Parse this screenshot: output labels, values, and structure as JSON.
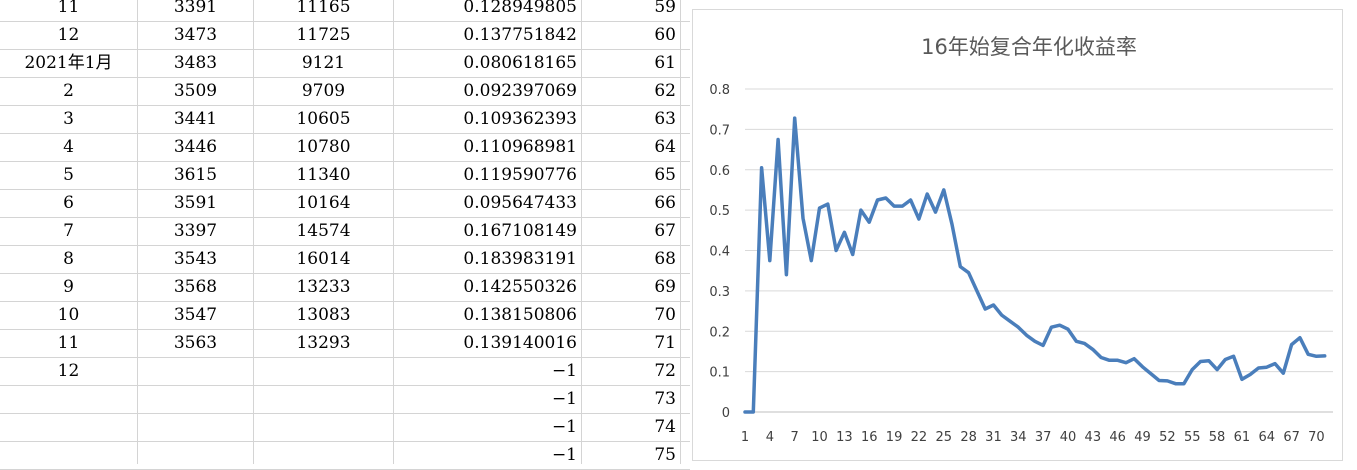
{
  "sheet": {
    "rows": [
      {
        "a": "11",
        "b": "3391",
        "c": "11165",
        "d": "0.128949805",
        "e": "59"
      },
      {
        "a": "12",
        "b": "3473",
        "c": "11725",
        "d": "0.137751842",
        "e": "60"
      },
      {
        "a": "2021年1月",
        "b": "3483",
        "c": "9121",
        "d": "0.080618165",
        "e": "61"
      },
      {
        "a": "2",
        "b": "3509",
        "c": "9709",
        "d": "0.092397069",
        "e": "62"
      },
      {
        "a": "3",
        "b": "3441",
        "c": "10605",
        "d": "0.109362393",
        "e": "63"
      },
      {
        "a": "4",
        "b": "3446",
        "c": "10780",
        "d": "0.110968981",
        "e": "64"
      },
      {
        "a": "5",
        "b": "3615",
        "c": "11340",
        "d": "0.119590776",
        "e": "65"
      },
      {
        "a": "6",
        "b": "3591",
        "c": "10164",
        "d": "0.095647433",
        "e": "66"
      },
      {
        "a": "7",
        "b": "3397",
        "c": "14574",
        "d": "0.167108149",
        "e": "67"
      },
      {
        "a": "8",
        "b": "3543",
        "c": "16014",
        "d": "0.183983191",
        "e": "68"
      },
      {
        "a": "9",
        "b": "3568",
        "c": "13233",
        "d": "0.142550326",
        "e": "69"
      },
      {
        "a": "10",
        "b": "3547",
        "c": "13083",
        "d": "0.138150806",
        "e": "70"
      },
      {
        "a": "11",
        "b": "3563",
        "c": "13293",
        "d": "0.139140016",
        "e": "71"
      },
      {
        "a": "12",
        "b": "",
        "c": "",
        "d": "−1",
        "e": "72"
      },
      {
        "a": "",
        "b": "",
        "c": "",
        "d": "−1",
        "e": "73"
      },
      {
        "a": "",
        "b": "",
        "c": "",
        "d": "−1",
        "e": "74"
      },
      {
        "a": "",
        "b": "",
        "c": "",
        "d": "−1",
        "e": "75"
      }
    ]
  },
  "chart_data": {
    "type": "line",
    "title": "16年始复合年化收益率",
    "xlabel": "",
    "ylabel": "",
    "ylim": [
      0,
      0.8
    ],
    "yticks": [
      "0",
      "0.1",
      "0.2",
      "0.3",
      "0.4",
      "0.5",
      "0.6",
      "0.7",
      "0.8"
    ],
    "xticks": [
      "1",
      "4",
      "7",
      "10",
      "13",
      "16",
      "19",
      "22",
      "25",
      "28",
      "31",
      "34",
      "37",
      "40",
      "43",
      "46",
      "49",
      "52",
      "55",
      "58",
      "61",
      "64",
      "67",
      "70"
    ],
    "grid": true,
    "legend": "none",
    "line_color": "#4a7ebb",
    "x": [
      1,
      2,
      3,
      4,
      5,
      6,
      7,
      8,
      9,
      10,
      11,
      12,
      13,
      14,
      15,
      16,
      17,
      18,
      19,
      20,
      21,
      22,
      23,
      24,
      25,
      26,
      27,
      28,
      29,
      30,
      31,
      32,
      33,
      34,
      35,
      36,
      37,
      38,
      39,
      40,
      41,
      42,
      43,
      44,
      45,
      46,
      47,
      48,
      49,
      50,
      51,
      52,
      53,
      54,
      55,
      56,
      57,
      58,
      59,
      60,
      61,
      62,
      63,
      64,
      65,
      66,
      67,
      68,
      69,
      70,
      71
    ],
    "values": [
      0,
      0,
      0.605,
      0.375,
      0.675,
      0.34,
      0.728,
      0.48,
      0.375,
      0.505,
      0.515,
      0.4,
      0.445,
      0.39,
      0.5,
      0.47,
      0.525,
      0.53,
      0.51,
      0.51,
      0.525,
      0.478,
      0.54,
      0.495,
      0.55,
      0.465,
      0.36,
      0.345,
      0.3,
      0.255,
      0.265,
      0.24,
      0.225,
      0.21,
      0.19,
      0.175,
      0.165,
      0.21,
      0.215,
      0.205,
      0.175,
      0.17,
      0.155,
      0.135,
      0.128,
      0.128,
      0.122,
      0.132,
      0.112,
      0.095,
      0.078,
      0.077,
      0.07,
      0.07,
      0.105,
      0.125,
      0.127,
      0.105,
      0.13,
      0.138,
      0.081,
      0.093,
      0.109,
      0.111,
      0.12,
      0.096,
      0.167,
      0.184,
      0.143,
      0.138,
      0.139
    ]
  }
}
